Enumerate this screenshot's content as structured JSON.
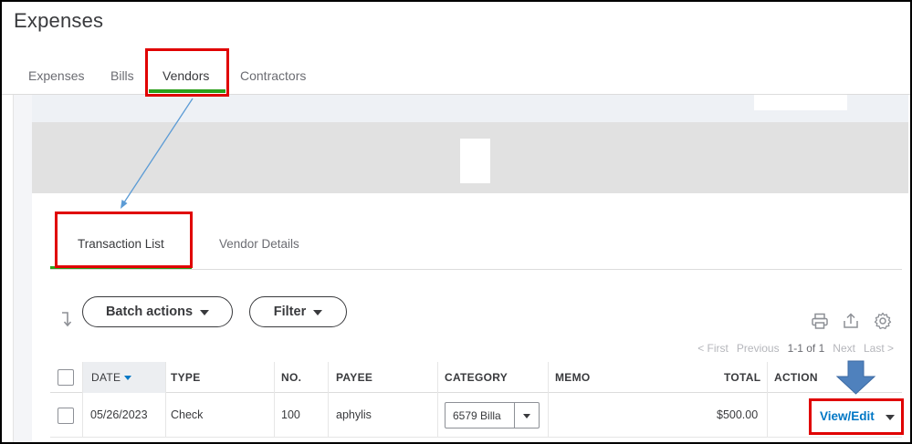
{
  "page": {
    "title": "Expenses"
  },
  "top_tabs": [
    {
      "label": "Expenses",
      "active": false
    },
    {
      "label": "Bills",
      "active": false
    },
    {
      "label": "Vendors",
      "active": true
    },
    {
      "label": "Contractors",
      "active": false
    }
  ],
  "sub_tabs": [
    {
      "label": "Transaction List",
      "active": true
    },
    {
      "label": "Vendor Details",
      "active": false
    }
  ],
  "toolbar": {
    "batch_actions_label": "Batch actions",
    "filter_label": "Filter",
    "icons": [
      "sort-icon",
      "print-icon",
      "export-icon",
      "settings-gear-icon"
    ]
  },
  "pager": {
    "first": "< First",
    "previous": "Previous",
    "range": "1-1 of 1",
    "next": "Next",
    "last": "Last >"
  },
  "table": {
    "columns": [
      "DATE",
      "TYPE",
      "NO.",
      "PAYEE",
      "CATEGORY",
      "MEMO",
      "TOTAL",
      "ACTION"
    ],
    "sorted_column": "DATE",
    "rows": [
      {
        "date": "05/26/2023",
        "type": "Check",
        "no": "100",
        "payee": "aphylis",
        "category": "6579 Billa",
        "memo": "",
        "total": "$500.00",
        "action": "View/Edit"
      }
    ]
  },
  "colors": {
    "accent_green": "#2ca01c",
    "link_blue": "#0077c5",
    "annotation_red": "#e00000",
    "annotation_arrow_blue": "#4f81bd",
    "gray_band": "#e1e1e1"
  }
}
